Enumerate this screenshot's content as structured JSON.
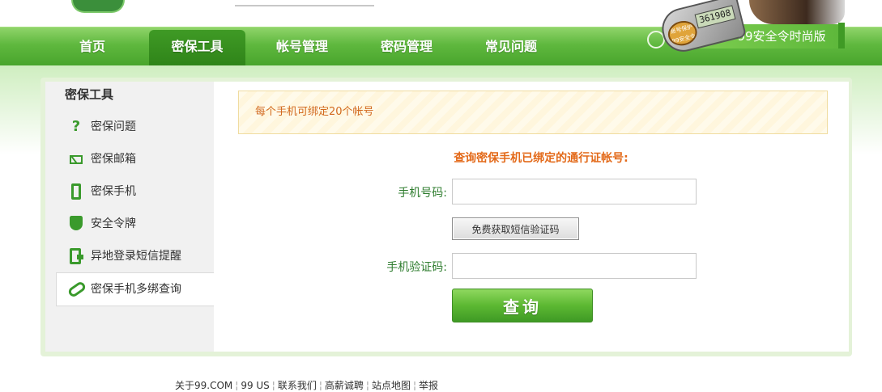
{
  "header": {
    "nav": [
      {
        "label": "首页"
      },
      {
        "label": "密保工具"
      },
      {
        "label": "帐号管理"
      },
      {
        "label": "密码管理"
      },
      {
        "label": "常见问题"
      }
    ],
    "banner": {
      "label": "99安全令时尚版",
      "token_display": "361908",
      "token_badge": "账号保护 99安全令"
    }
  },
  "sidebar": {
    "title": "密保工具",
    "items": [
      {
        "label": "密保问题",
        "icon": "question-icon"
      },
      {
        "label": "密保邮箱",
        "icon": "mail-icon"
      },
      {
        "label": "密保手机",
        "icon": "phone-icon"
      },
      {
        "label": "安全令牌",
        "icon": "shield-icon"
      },
      {
        "label": "异地登录短信提醒",
        "icon": "sms-phone-icon"
      },
      {
        "label": "密保手机多绑查询",
        "icon": "link-icon"
      }
    ]
  },
  "main": {
    "notice": "每个手机可绑定20个帐号",
    "title": "查询密保手机已绑定的通行证帐号:",
    "phone_label": "手机号码:",
    "phone_value": "",
    "sms_button": "免费获取短信验证码",
    "code_label": "手机验证码:",
    "code_value": "",
    "query_button": "查询"
  },
  "footer": {
    "links": [
      "关于99.COM",
      "99 US",
      "联系我们",
      "高薪诚聘",
      "站点地图",
      "举报"
    ]
  },
  "colors": {
    "nav_green": "#5fb83e",
    "accent_orange": "#e36a1a",
    "label_green": "#2f7d2f"
  }
}
